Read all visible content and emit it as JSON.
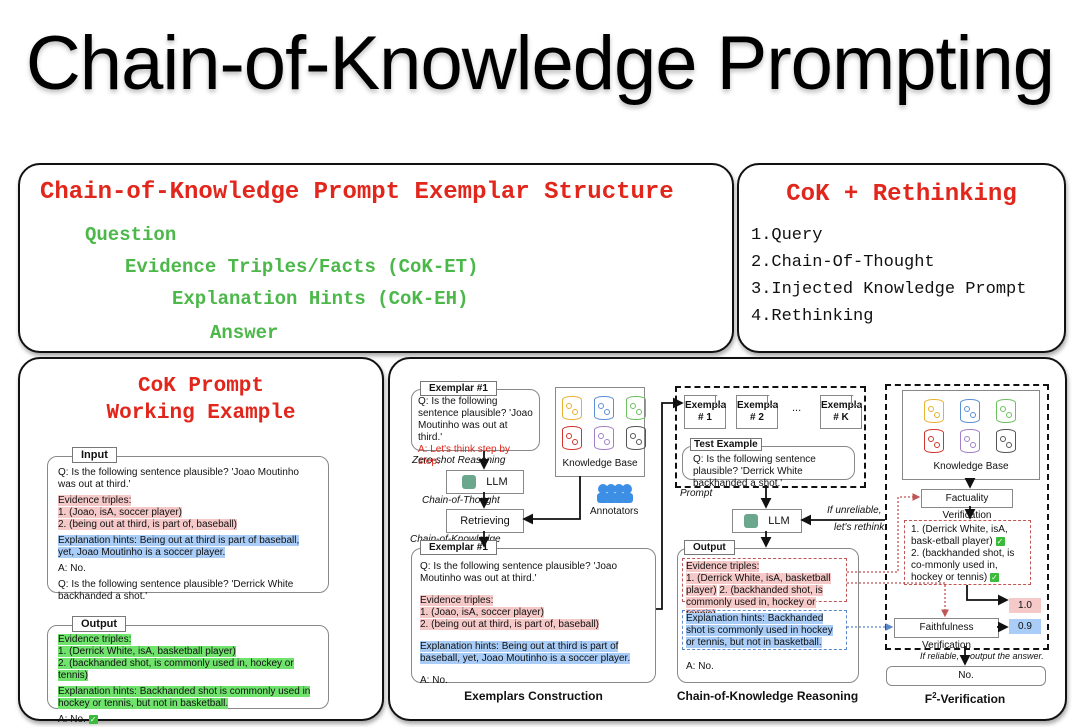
{
  "title": "Chain-of-Knowledge Prompting",
  "structure_panel": {
    "title": "Chain-of-Knowledge Prompt Exemplar Structure",
    "items": [
      "Question",
      "Evidence Triples/Facts (CoK-ET)",
      "Explanation Hints (CoK-EH)",
      "Answer"
    ]
  },
  "rethinking_panel": {
    "title": "CoK + Rethinking",
    "items": [
      "1.Query",
      "2.Chain-Of-Thought",
      "3.Injected Knowledge Prompt",
      "4.Rethinking"
    ]
  },
  "working_example": {
    "title_line1": "CoK Prompt",
    "title_line2": "Working Example",
    "input": {
      "label": "Input",
      "q1": "Q: Is the following sentence plausible? 'Joao Moutinho was out at third.'",
      "evidence_label": "Evidence triples:",
      "evidence": [
        "1. (Joao, isA, soccer player)",
        "2. (being out at third, is part of, baseball)"
      ],
      "hints": "Explanation hints: Being out at third is part of baseball, yet, Joao Moutinho is a soccer player.",
      "answer": "A: No.",
      "q2": "Q: Is the following sentence plausible? 'Derrick White backhanded a shot.'"
    },
    "output": {
      "label": "Output",
      "evidence_label": "Evidence triples:",
      "evidence": [
        "1. (Derrick White, isA, basketball player)",
        "2. (backhanded shot, is commonly used in, hockey or tennis)"
      ],
      "hints": "Explanation hints: Backhanded shot is commonly used in hockey or tennis, but not in basketball.",
      "answer": "A: No.",
      "check": "✓"
    }
  },
  "exemplars_construction": {
    "caption": "Exemplars Construction",
    "exemplar_top": {
      "label": "Exemplar #1",
      "question": "Q: Is the following sentence plausible? 'Joao Moutinho was out at third.'",
      "cot_prompt": "A: Let's think step by step."
    },
    "zero_shot_label": "Zero-shot Reasoning",
    "llm_label": "LLM",
    "cot_label": "Chain-of-Thought",
    "retrieving_label": "Retrieving",
    "cok_label": "Chain-of-Knowledge",
    "knowledge_base_label": "Knowledge Base",
    "annotators_label": "Annotators",
    "exemplar_bottom": {
      "label": "Exemplar #1",
      "question": "Q: Is the following sentence plausible? 'Joao Moutinho was out at third.'",
      "evidence_label": "Evidence triples:",
      "evidence": [
        "1. (Joao, isA, soccer player)",
        "2. (being out at third, is part of, baseball)"
      ],
      "hints": "Explanation hints: Being out at third is part of baseball, yet, Joao Moutinho is a soccer player.",
      "answer": "A: No."
    }
  },
  "cok_reasoning": {
    "caption": "Chain-of-Knowledge Reasoning",
    "exemplars": [
      {
        "line1": "Exemplar",
        "line2": "# 1"
      },
      {
        "line1": "Exemplar",
        "line2": "# 2"
      },
      {
        "line1": "Exemplar",
        "line2": "# K"
      }
    ],
    "ellipsis": "...",
    "test_label": "Test Example",
    "test_question": "Q: Is the following sentence plausible? 'Derrick White backhanded a shot.'",
    "prompt_label": "Prompt",
    "llm_label": "LLM",
    "rethink_line1": "If unreliable,",
    "rethink_line2": "let's rethink.",
    "output_label": "Output",
    "evidence_label": "Evidence triples:",
    "evidence": [
      "1. (Derrick White, isA, basketball player)",
      "2. (backhanded shot, is commonly used in, hockey or tennis)"
    ],
    "hints": "Explanation hints: Backhanded shot is commonly used in hockey or tennis, but not in basketball.",
    "answer": "A: No."
  },
  "verification": {
    "caption_prefix": "F",
    "caption_sup": "2",
    "caption_suffix": "-Verification",
    "knowledge_base_label": "Knowledge Base",
    "factuality_label": "Factuality Verification",
    "facts": [
      "1. (Derrick White, isA, bask-etball player)",
      "2. (backhanded shot, is co-mmonly used in, hockey or tennis)"
    ],
    "faithfulness_label": "Faithfulness Verification",
    "factuality_score": "1.0",
    "faithfulness_score": "0.9",
    "reliable_line1": "If reliable,",
    "reliable_line2": "output the answer.",
    "final_answer": "No.",
    "check": "✓"
  },
  "colors": {
    "title_red": "#e1261c",
    "structure_green": "#4cb84a",
    "evidence_pink": "#f6c9c9",
    "hint_blue": "#a9cdf7",
    "output_green": "#6fe36c",
    "kb_colors": [
      "#e8b230",
      "#5b8fd6",
      "#6bbf5f",
      "#d2362c",
      "#a27fc7",
      "#555555"
    ]
  }
}
